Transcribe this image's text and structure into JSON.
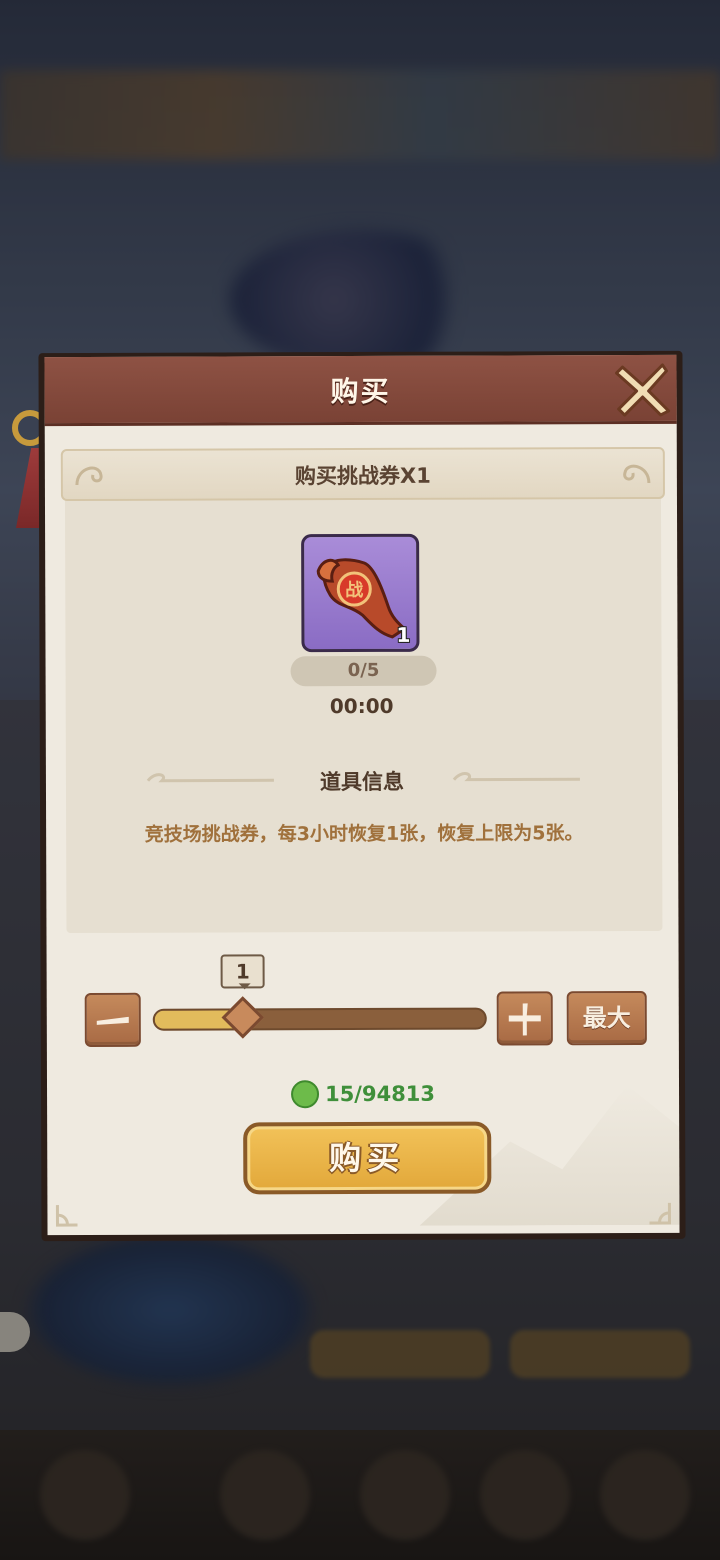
{
  "dialog": {
    "title": "购买",
    "subtitle": "购买挑战券X1",
    "item": {
      "count": "1",
      "stock": "0/5",
      "timer": "00:00",
      "icon": "battle-ticket-scroll-icon"
    },
    "info_title": "道具信息",
    "description": "竞技场挑战券，每3小时恢复1张，恢复上限为5张。",
    "quantity": {
      "value": "1",
      "fill_fraction": 0.27,
      "minus_icon": "minus-icon",
      "plus_icon": "plus-icon",
      "max_label": "最大"
    },
    "cost": {
      "value": "15/94813",
      "icon": "jade-coin-icon"
    },
    "buy_label": "购买"
  },
  "colors": {
    "header": "#8e5244",
    "panel": "#efeae0",
    "accent_gold": "#f2c259",
    "cost_green": "#3f8f3a",
    "desc_brown": "#a0713c"
  }
}
